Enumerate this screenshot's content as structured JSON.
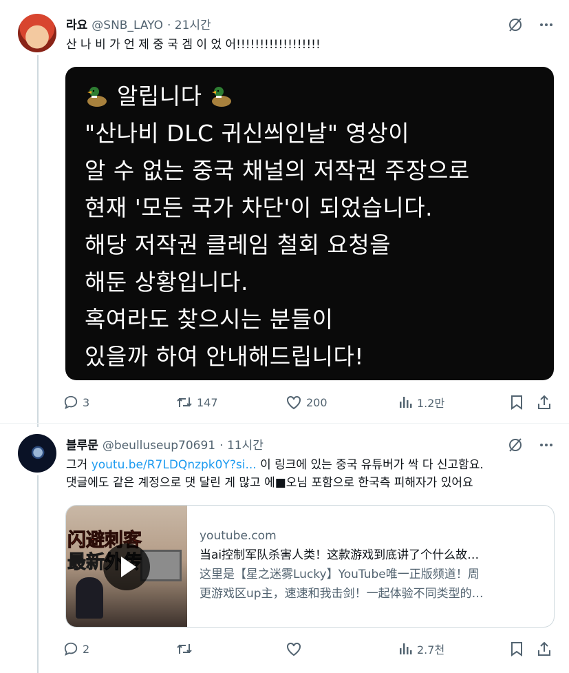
{
  "tweets": [
    {
      "author_name": "라요",
      "handle": "@SNB_LAYO",
      "time": "· 21시간",
      "text": "산 나 비 가 언 제 중 국 겜 이 었 어!!!!!!!!!!!!!!!!!!",
      "notice_lines": [
        "알립니다",
        "\"산나비 DLC 귀신씌인날\" 영상이",
        "알 수 없는 중국 채널의 저작권 주장으로",
        "현재 '모든 국가 차단'이 되었습니다.",
        "해당 저작권 클레임 철회 요청을",
        "해둔 상황입니다.",
        "혹여라도 찾으시는 분들이",
        "있을까 하여 안내해드립니다!"
      ],
      "actions": {
        "replies": "3",
        "reposts": "147",
        "likes": "200",
        "views": "1.2만"
      }
    },
    {
      "author_name": "블루문",
      "handle": "@beulluseup70691",
      "time": "· 11시간",
      "text_prefix": "그거 ",
      "link": "youtu.be/R7LDQnzpk0Y?si...",
      "text_suffix": " 이 링크에 있는 중국 유튜버가 싹 다 신고함요.",
      "text_line2": "댓글에도 같은 계정으로 댓 달린 게 많고 에■오님 포함으로 한국측 피해자가 있어요",
      "card": {
        "thumb_line1": "闪避刺客",
        "thumb_line2": "最新外传",
        "domain": "youtube.com",
        "title": "当ai控制军队杀害人类！这款游戏到底讲了个什么故…",
        "desc_line1": "这里是【星之迷雾Lucky】YouTube唯一正版频道！周",
        "desc_line2": "更游戏区up主，速速和我击剑！一起体验不同类型的…"
      },
      "actions": {
        "replies": "2",
        "reposts": "",
        "likes": "",
        "views": "2.7천"
      }
    }
  ]
}
